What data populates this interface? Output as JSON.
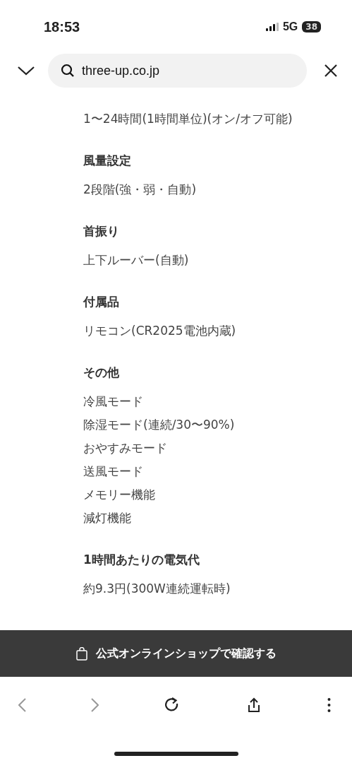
{
  "status_bar": {
    "time": "18:53",
    "network": "5G",
    "battery": "38"
  },
  "address_bar": {
    "url": "three-up.co.jp"
  },
  "specs": [
    {
      "values": [
        "1〜24時間(1時間単位)(オン/オフ可能)"
      ]
    },
    {
      "label": "風量設定",
      "values": [
        "2段階(強・弱・自動)"
      ]
    },
    {
      "label": "首振り",
      "values": [
        "上下ルーバー(自動)"
      ]
    },
    {
      "label": "付属品",
      "values": [
        "リモコン(CR2025電池内蔵)"
      ]
    },
    {
      "label": "その他",
      "values": [
        "冷風モード",
        "除湿モード(連続/30〜90%)",
        "おやすみモード",
        "送風モード",
        "メモリー機能",
        "減灯機能"
      ]
    },
    {
      "label": "1時間あたりの電気代",
      "values": [
        "約9.3円(300W連続運転時)"
      ]
    }
  ],
  "shop_banner": {
    "label": "公式オンラインショップで確認する"
  },
  "toolbar": [
    {
      "kind": "back",
      "disabled": true
    },
    {
      "kind": "forward",
      "disabled": true
    },
    {
      "kind": "reload",
      "disabled": false
    },
    {
      "kind": "share",
      "disabled": false
    },
    {
      "kind": "more",
      "disabled": false
    }
  ]
}
